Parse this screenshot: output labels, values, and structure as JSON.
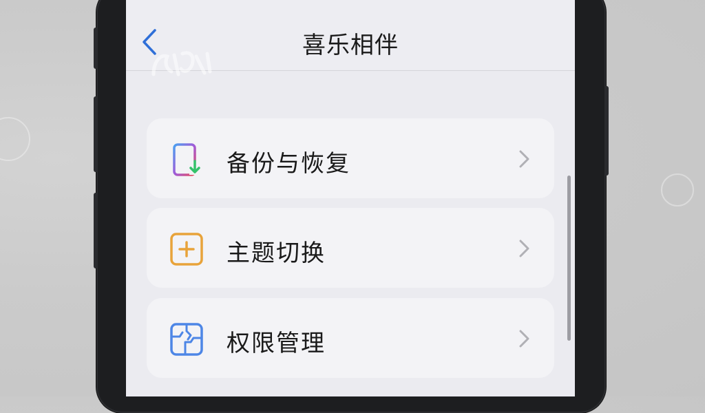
{
  "nav": {
    "title": "喜乐相伴",
    "back_icon": "chevron-left-icon"
  },
  "menu": {
    "items": [
      {
        "label": "备份与恢复",
        "icon": "backup-restore-icon"
      },
      {
        "label": "主题切换",
        "icon": "theme-switch-icon"
      },
      {
        "label": "权限管理",
        "icon": "permission-management-icon"
      }
    ]
  },
  "colors": {
    "accent": "#2f6fd8",
    "theme_icon": "#e8a33a",
    "permission_icon": "#4d86e6",
    "chevron": "#b0b0b5"
  }
}
